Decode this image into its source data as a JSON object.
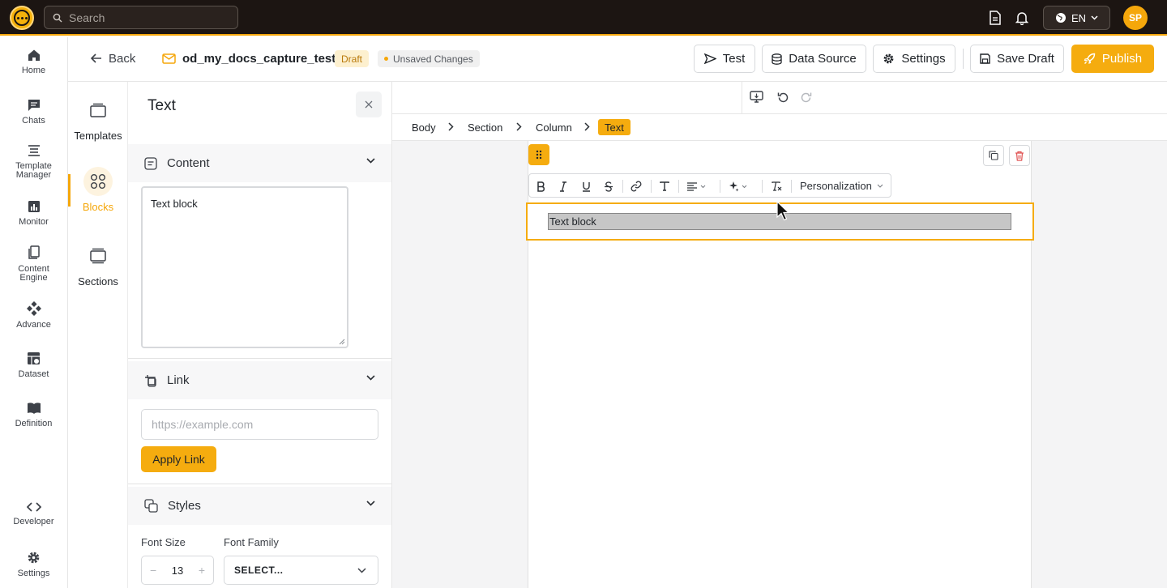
{
  "topbar": {
    "search_placeholder": "Search",
    "language": "EN",
    "user_initials": "SP",
    "icons": [
      "document-icon",
      "bell-icon",
      "globe-icon"
    ]
  },
  "rail": {
    "items": [
      {
        "label": "Home",
        "icon": "home-icon"
      },
      {
        "label": "Chats",
        "icon": "chat-icon"
      },
      {
        "label": "Template Manager",
        "icon": "template-manager-icon"
      },
      {
        "label": "Monitor",
        "icon": "monitor-icon"
      },
      {
        "label": "Content Engine",
        "icon": "content-engine-icon"
      },
      {
        "label": "Advance",
        "icon": "advance-icon"
      },
      {
        "label": "Dataset",
        "icon": "dataset-icon"
      },
      {
        "label": "Definition",
        "icon": "book-icon"
      },
      {
        "label": "Developer",
        "icon": "code-icon"
      },
      {
        "label": "Settings",
        "icon": "gear-icon"
      }
    ]
  },
  "header": {
    "back_label": "Back",
    "doc_name": "od_my_docs_capture_test",
    "status_badge": "Draft",
    "unsaved_badge": "Unsaved Changes",
    "test_label": "Test",
    "data_source_label": "Data Source",
    "settings_label": "Settings",
    "save_draft_label": "Save Draft",
    "publish_label": "Publish",
    "accent_color": "#f5ac0f"
  },
  "blocks_column": {
    "items": [
      {
        "label": "Templates",
        "active": false
      },
      {
        "label": "Blocks",
        "active": true
      },
      {
        "label": "Sections",
        "active": false
      }
    ]
  },
  "panel": {
    "title": "Text",
    "content_section": "Content",
    "content_text": "Text block",
    "link_section": "Link",
    "link_placeholder": "https://example.com",
    "apply_link_label": "Apply Link",
    "styles_section": "Styles",
    "font_size_label": "Font Size",
    "font_size_value": "13",
    "font_family_label": "Font Family",
    "font_family_value": "SELECT..."
  },
  "canvas": {
    "breadcrumb": [
      "Body",
      "Section",
      "Column",
      "Text"
    ],
    "personalization_label": "Personalization",
    "text_block": "Text block"
  }
}
